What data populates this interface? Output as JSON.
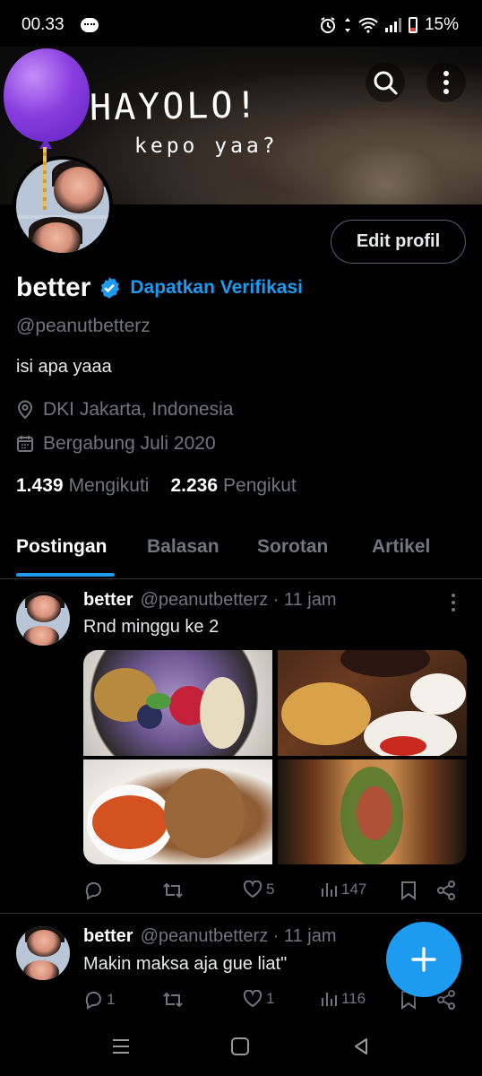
{
  "status_bar": {
    "time": "00.33",
    "battery": "15%"
  },
  "banner": {
    "title": "HAYOLO!",
    "subtitle": "kepo yaa?"
  },
  "profile": {
    "edit_button": "Edit profil",
    "display_name": "better",
    "get_verified": "Dapatkan Verifikasi",
    "handle": "@peanutbetterz",
    "bio": "isi apa yaaa",
    "location": "DKI Jakarta, Indonesia",
    "joined": "Bergabung Juli 2020",
    "following_count": "1.439",
    "following_label": "Mengikuti",
    "followers_count": "2.236",
    "followers_label": "Pengikut"
  },
  "tabs": [
    {
      "label": "Postingan",
      "active": true
    },
    {
      "label": "Balasan",
      "active": false
    },
    {
      "label": "Sorotan",
      "active": false
    },
    {
      "label": "Artikel",
      "active": false
    }
  ],
  "posts": [
    {
      "name": "better",
      "handle_time": "@peanutbetterz · 11 jam",
      "text": "Rnd minggu ke 2",
      "replies": "",
      "reposts": "",
      "likes": "5",
      "views": "147"
    },
    {
      "name": "better",
      "handle_time": "@peanutbetterz · 11 jam",
      "text": "Makin maksa aja gue liat\"",
      "replies": "1",
      "reposts": "",
      "likes": "1",
      "views": "116"
    }
  ],
  "colors": {
    "accent": "#1d9bf0",
    "muted": "#71767b",
    "background": "#000000"
  },
  "icons": [
    "search-icon",
    "more-vert-icon",
    "verified-icon",
    "location-icon",
    "calendar-icon",
    "reply-icon",
    "repost-icon",
    "like-icon",
    "views-icon",
    "bookmark-icon",
    "share-icon",
    "plus-icon"
  ]
}
